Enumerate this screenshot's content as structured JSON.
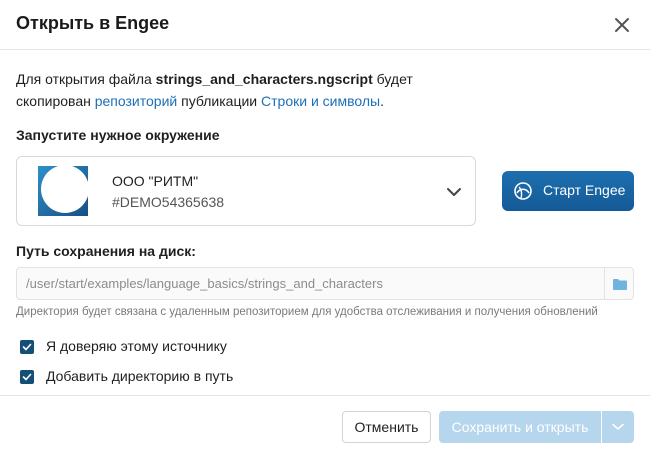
{
  "dialog": {
    "title": "Открыть в Engee"
  },
  "description": {
    "line1_prefix": "Для открытия файла ",
    "file_name": "strings_and_characters.ngscript",
    "line1_suffix": " будет",
    "line2_prefix": "скопирован ",
    "repo_link": "репозиторий",
    "line2_middle": " публикации ",
    "publication_link": "Строки и символы",
    "line2_suffix": "."
  },
  "environment": {
    "label": "Запустите нужное окружение",
    "name": "ООО \"РИТМ\"",
    "id": "#DEMO54365638",
    "start_button": "Старт Engee"
  },
  "save_path": {
    "label": "Путь сохранения на диск:",
    "value": "/user/start/examples/language_basics/strings_and_characters",
    "hint": "Директория будет связана с удаленным репозиторием для удобства отслеживания и получения обновлений"
  },
  "options": [
    {
      "label": "Я доверяю этому источнику",
      "checked": true
    },
    {
      "label": "Добавить директорию в путь",
      "checked": true
    }
  ],
  "footer": {
    "cancel": "Отменить",
    "save_open": "Сохранить и открыть"
  },
  "colors": {
    "accent": "#1d6fb8",
    "primary_button": "#145a96",
    "disabled_button": "#b6d6ee",
    "checkbox": "#154f78"
  },
  "icons": {
    "close": "close-icon",
    "chevron": "chevron-down-icon",
    "start": "engee-logo-icon",
    "folder": "folder-icon",
    "check": "check-icon"
  }
}
